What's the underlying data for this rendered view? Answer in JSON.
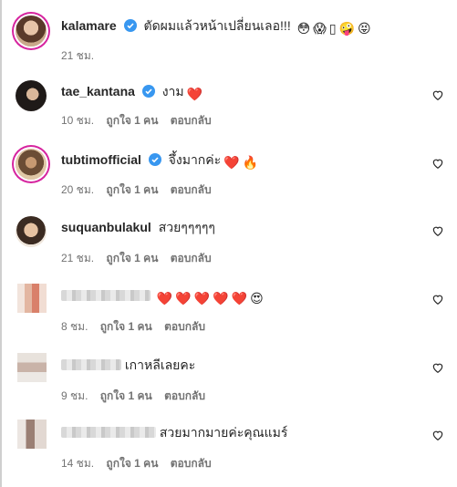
{
  "comments": [
    {
      "user": "kalamare",
      "verified": true,
      "text": "ตัดผมแล้วหน้าเปลี่ยนเลอ!!!",
      "emoji": [
        "😳",
        "😱",
        "▯",
        "🤪",
        "😝"
      ],
      "time": "21 ชม.",
      "likes": "",
      "reply": ""
    },
    {
      "user": "tae_kantana",
      "verified": true,
      "text": "งาม",
      "emoji": [
        "❤️"
      ],
      "time": "10 ชม.",
      "likes": "ถูกใจ 1 คน",
      "reply": "ตอบกลับ"
    },
    {
      "user": "tubtimofficial",
      "verified": true,
      "text": "จึ้งมากค่ะ",
      "emoji": [
        "❤️",
        "🔥"
      ],
      "time": "20 ชม.",
      "likes": "ถูกใจ 1 คน",
      "reply": "ตอบกลับ"
    },
    {
      "user": "suquanbulakul",
      "verified": false,
      "text": "สวยๆๆๆๆๆ",
      "emoji": [],
      "time": "21 ชม.",
      "likes": "ถูกใจ 1 คน",
      "reply": "ตอบกลับ"
    },
    {
      "user": "",
      "verified": false,
      "text": "",
      "emoji": [
        "❤️",
        "❤️",
        "❤️",
        "❤️",
        "❤️",
        "😍"
      ],
      "time": "8 ชม.",
      "likes": "ถูกใจ 1 คน",
      "reply": "ตอบกลับ"
    },
    {
      "user": "",
      "verified": false,
      "text": "เกาหลีเลยคะ",
      "emoji": [],
      "time": "9 ชม.",
      "likes": "ถูกใจ 1 คน",
      "reply": "ตอบกลับ"
    },
    {
      "user": "",
      "verified": false,
      "text": "สวยมากมายค่ะคุณแมร์",
      "emoji": [],
      "time": "14 ชม.",
      "likes": "ถูกใจ 1 คน",
      "reply": "ตอบกลับ"
    }
  ],
  "colors": {
    "verified": "#3897f0",
    "heart": "#ed4956",
    "meta": "#737373",
    "story_ring": "#d6249f"
  }
}
